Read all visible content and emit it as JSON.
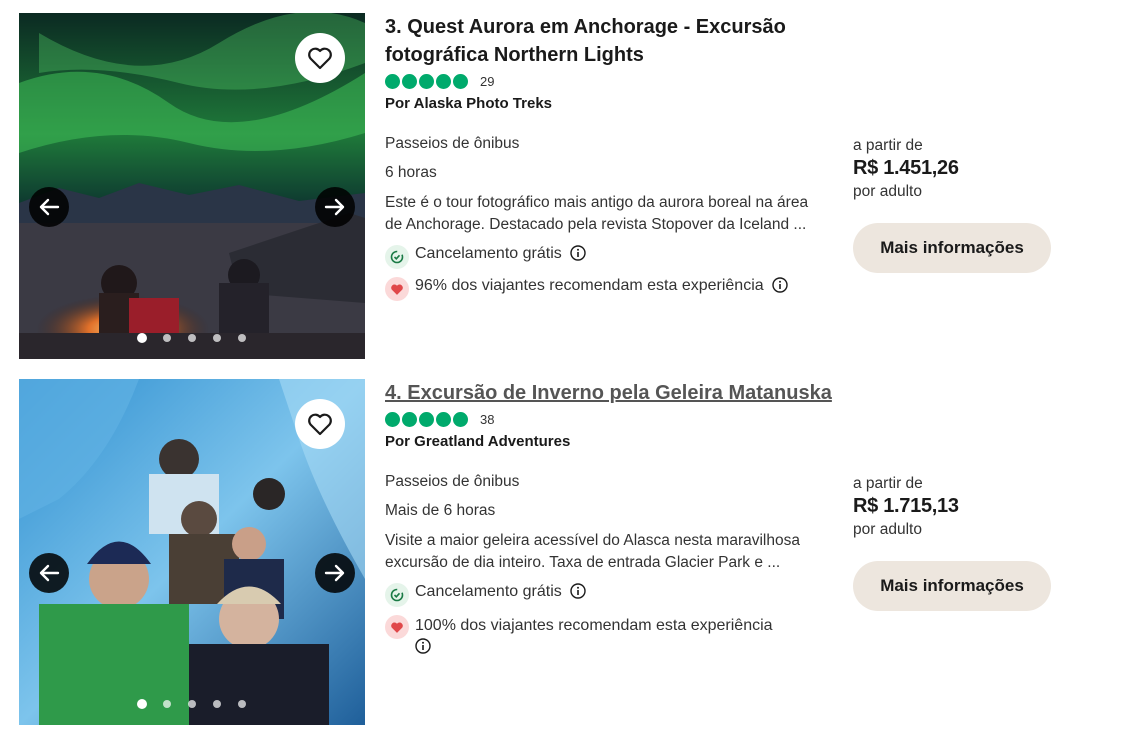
{
  "listings": [
    {
      "title": "3. Quest Aurora em Anchorage - Excursão fotográfica Northern Lights",
      "rating_count": "29",
      "rating_bubbles": 5,
      "operator": "Por Alaska Photo Treks",
      "category": "Passeios de ônibus",
      "duration": "6 horas",
      "description": "Este é o tour fotográfico mais antigo da aurora boreal na área de Anchorage. Destacado pela revista Stopover da Iceland ...",
      "free_cancel": "Cancelamento grátis",
      "recommend": "96% dos viajantes recomendam esta experiência",
      "price_from": "a partir de",
      "price": "R$ 1.451,26",
      "price_per": "por adulto",
      "cta": "Mais informações",
      "image_dots": 5,
      "active_dot": 0
    },
    {
      "title": "4. Excursão de Inverno pela Geleira Matanuska",
      "rating_count": "38",
      "rating_bubbles": 5,
      "operator": "Por Greatland Adventures",
      "category": "Passeios de ônibus",
      "duration": "Mais de 6 horas",
      "description": "Visite a maior geleira acessível do Alasca nesta maravilhosa excursão de dia inteiro. Taxa de entrada Glacier Park e ...",
      "free_cancel": "Cancelamento grátis",
      "recommend": "100% dos viajantes recomendam esta experiência",
      "price_from": "a partir de",
      "price": "R$ 1.715,13",
      "price_per": "por adulto",
      "cta": "Mais informações",
      "image_dots": 5,
      "active_dot": 0
    }
  ],
  "icons": {
    "favorite": "heart-outline-icon",
    "prev": "arrow-left-icon",
    "next": "arrow-right-icon",
    "cancel": "refresh-check-icon",
    "recommend": "heart-filled-icon",
    "info": "info-circle-icon"
  },
  "colors": {
    "rating_green": "#00aa6c",
    "button_bg": "#ede6de",
    "heart_red": "#e0484a"
  }
}
